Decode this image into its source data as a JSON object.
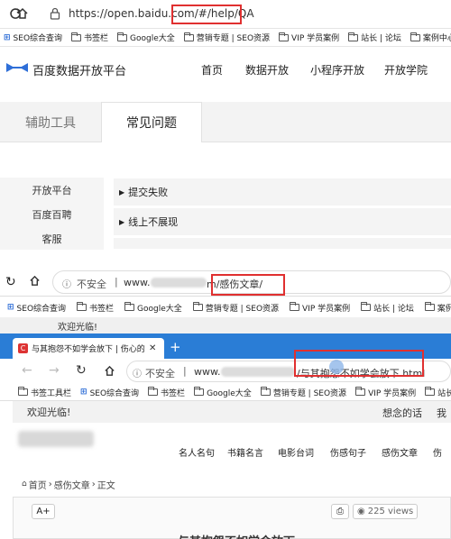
{
  "panel1": {
    "url": "https://open.baidu.com/#/help/QA",
    "bookmarks": [
      "SEO综合查询",
      "书签栏",
      "Google大全",
      "营销专题 | SEO资源",
      "VIP 学员案例",
      "站长 | 论坛",
      "案例中心"
    ],
    "logo_text": "百度数据开放平台",
    "nav": [
      "首页",
      "数据开放",
      "小程序开放",
      "开放学院"
    ],
    "tabs": [
      "辅助工具",
      "常见问题"
    ],
    "side_items": [
      "开放平台",
      "百度百聘",
      "客服"
    ],
    "faq_items": [
      "提交失败",
      "线上不展现"
    ]
  },
  "panel2": {
    "insecure": "不安全",
    "url_prefix": "www.",
    "url_suffix": "m/感伤文章/",
    "bookmarks": [
      "SEO综合查询",
      "书签栏",
      "Google大全",
      "营销专题 | SEO资源",
      "VIP 学员案例",
      "站长 | 论坛",
      "案例中"
    ],
    "welcome": "欢迎光临!"
  },
  "panel3": {
    "tab_title": "与其抱怨不如学会放下 | 伤心的",
    "insecure": "不安全",
    "url_prefix": "www.",
    "url_suffix": "/与其抱怨不如学会放下.html",
    "bookmarks": [
      "书签工具栏",
      "SEO综合查询",
      "书签栏",
      "Google大全",
      "营销专题 | SEO资源",
      "VIP 学员案例",
      "站长"
    ],
    "welcome": "欢迎光临!",
    "welcome_right": "想念的话",
    "welcome_right2": "我",
    "nav": [
      "名人名句",
      "书籍名言",
      "电影台词",
      "伤感句子",
      "感伤文章",
      "伤"
    ],
    "breadcrumb": [
      "首页",
      "感伤文章",
      "正文"
    ],
    "font_button": "A+",
    "views": "225 views",
    "title_fragment": "与其抱怨不如学会放下"
  }
}
